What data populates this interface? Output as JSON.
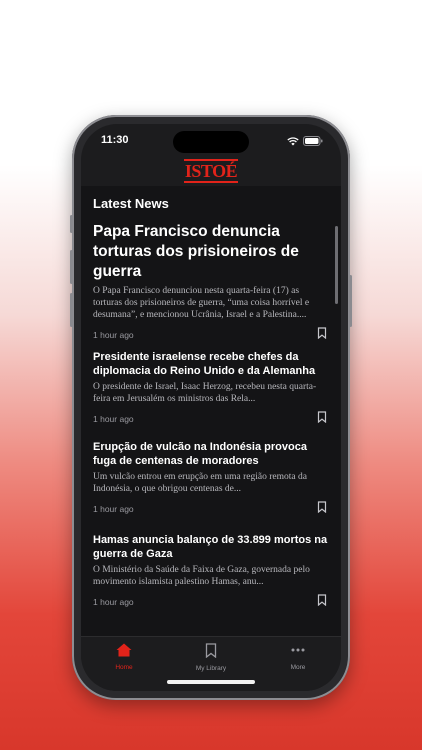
{
  "status_bar": {
    "time": "11:30"
  },
  "app": {
    "logo_text": "ISTOÉ",
    "brand_color": "#e2231a"
  },
  "section": {
    "title": "Latest News"
  },
  "articles": [
    {
      "title": "Papa Francisco denuncia torturas dos prisioneiros de guerra",
      "excerpt": "O Papa Francisco denunciou nesta quarta-feira (17) as torturas dos prisioneiros de guerra, “uma coisa horrível e desumana”, e mencionou Ucrânia, Israel e a Palestina....",
      "time": "1 hour ago"
    },
    {
      "title": "Presidente israelense recebe chefes da diplomacia do Reino Unido e da Alemanha",
      "excerpt": "O presidente de Israel, Isaac Herzog, recebeu nesta quarta-feira em Jerusalém os ministros das Rela...",
      "time": "1 hour ago"
    },
    {
      "title": "Erupção de vulcão na Indonésia provoca fuga de centenas de moradores",
      "excerpt": "Um vulcão entrou em erupção em uma região remota da Indonésia, o que obrigou centenas de...",
      "time": "1 hour ago"
    },
    {
      "title": "Hamas anuncia balanço de 33.899 mortos na guerra de Gaza",
      "excerpt": "O Ministério da Saúde da Faixa de Gaza, governada pelo movimento islamista palestino Hamas, anu...",
      "time": "1 hour ago"
    }
  ],
  "tabbar": {
    "tabs": [
      {
        "label": "Home",
        "icon": "home-icon",
        "active": true
      },
      {
        "label": "My Library",
        "icon": "bookmark-icon",
        "active": false
      },
      {
        "label": "More",
        "icon": "more-icon",
        "active": false
      }
    ]
  }
}
